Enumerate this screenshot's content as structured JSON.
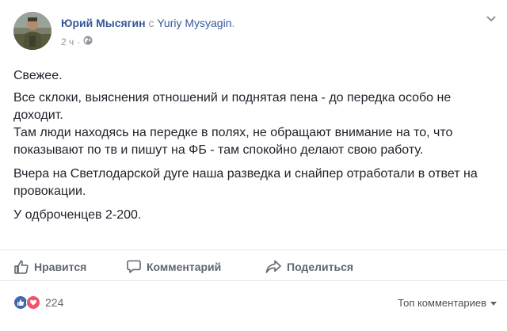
{
  "post": {
    "author": "Юрий Мысягин",
    "with_word": "с",
    "coauthor": "Yuriy Mysyagin",
    "meta_sep": ".",
    "time": "2 ч",
    "time_sep": "·",
    "privacy_icon": "globe-icon",
    "options_icon": "chevron-down-icon",
    "paragraphs": [
      "Свежее.",
      "Все склоки, выяснения отношений и поднятая пена - до передка особо не доходит.\nТам люди находясь на передке в полях, не обращают внимание на то, что показывают по тв и пишут на ФБ - там спокойно делают свою работу.",
      "Вчера на Светлодарской дуге наша разведка и снайпер отработали в ответ на провокации.",
      "У одброченцев 2-200."
    ]
  },
  "actions": {
    "like": {
      "label": "Нравится",
      "icon": "thumbs-up-icon"
    },
    "comment": {
      "label": "Комментарий",
      "icon": "comment-bubble-icon"
    },
    "share": {
      "label": "Поделиться",
      "icon": "share-arrow-icon"
    }
  },
  "reactions": {
    "icons": [
      "like-reaction-icon",
      "love-reaction-icon"
    ],
    "count": "224"
  },
  "comments_sort": {
    "label": "Топ комментариев",
    "icon": "caret-down-icon"
  },
  "colors": {
    "link": "#365899",
    "muted": "#90949c",
    "text": "#1d2129",
    "action": "#606770",
    "like_blue": "#4267b2",
    "love_red": "#f25268"
  }
}
